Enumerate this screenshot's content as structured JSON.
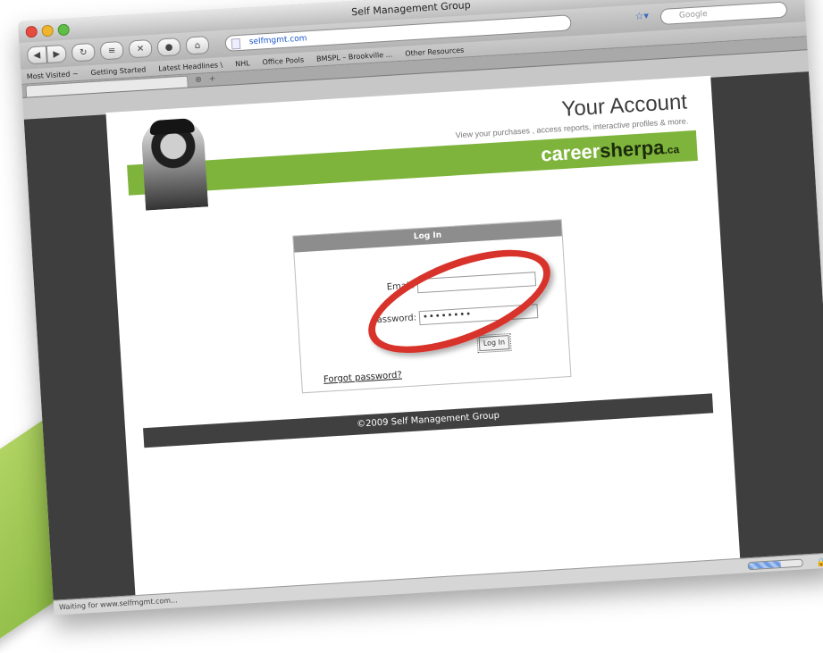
{
  "window": {
    "title": "Self Management Group"
  },
  "toolbar": {
    "url": "selfmgmt.com",
    "search_placeholder": "Google"
  },
  "bookmarks": [
    "Most Visited ~",
    "Getting Started",
    "Latest Headlines \\",
    "NHL",
    "Office Pools",
    "BMSPL – Brookville ...",
    "Other Resources"
  ],
  "tabstrip": {
    "close_glyph": "⊗",
    "new_glyph": "+"
  },
  "header": {
    "title": "Your Account",
    "subtitle": "View your purchases , access reports, interactive profiles & more.",
    "brand_a": "career",
    "brand_b": "sherpa",
    "brand_c": ".ca"
  },
  "login": {
    "heading": "Log In",
    "email_label": "Email:",
    "email_value": "",
    "password_label": "Password:",
    "password_value": "••••••••",
    "button": "Log In",
    "forgot": "Forgot password?"
  },
  "footer": {
    "text": "©2009 Self Management Group"
  },
  "status": {
    "text": "Waiting for www.selfmgmt.com...",
    "progress": 0.6
  },
  "colors": {
    "brand_green": "#7fb43c",
    "annotation_red": "#d8332a",
    "footer": "#404040"
  }
}
